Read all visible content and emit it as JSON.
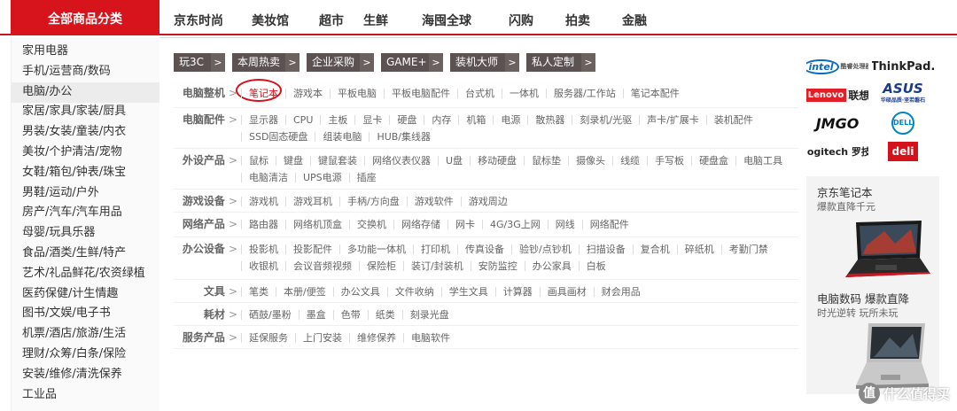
{
  "topnav": {
    "category_head": "全部商品分类",
    "links": [
      "京东时尚",
      "美妆馆",
      "超市",
      "生鲜",
      "海囤全球",
      "闪购",
      "拍卖",
      "金融"
    ]
  },
  "categories": [
    "家用电器",
    "手机/运营商/数码",
    "电脑/办公",
    "家居/家具/家装/厨具",
    "男装/女装/童装/内衣",
    "美妆/个护清洁/宠物",
    "女鞋/箱包/钟表/珠宝",
    "男鞋/运动/户外",
    "房产/汽车/汽车用品",
    "母婴/玩具乐器",
    "食品/酒类/生鲜/特产",
    "艺术/礼品鲜花/农资绿植",
    "医药保健/计生情趣",
    "图书/文娱/电子书",
    "机票/酒店/旅游/生活",
    "理财/众筹/白条/保险",
    "安装/维修/清洗保养",
    "工业品"
  ],
  "active_category_index": 2,
  "channels": [
    "玩3C",
    "本周热卖",
    "企业采购",
    "GAME+",
    "装机大师",
    "私人定制"
  ],
  "rows": [
    {
      "title": "电脑整机",
      "items": [
        "笔记本",
        "游戏本",
        "平板电脑",
        "平板电脑配件",
        "台式机",
        "一体机",
        "服务器/工作站",
        "笔记本配件"
      ]
    },
    {
      "title": "电脑配件",
      "items": [
        "显示器",
        "CPU",
        "主板",
        "显卡",
        "硬盘",
        "内存",
        "机箱",
        "电源",
        "散热器",
        "刻录机/光驱",
        "声卡/扩展卡",
        "装机配件",
        "SSD固态硬盘",
        "组装电脑",
        "HUB/集线器"
      ]
    },
    {
      "title": "外设产品",
      "items": [
        "鼠标",
        "键盘",
        "键鼠套装",
        "网络仪表仪器",
        "U盘",
        "移动硬盘",
        "鼠标垫",
        "摄像头",
        "线缆",
        "手写板",
        "硬盘盒",
        "电脑工具",
        "电脑清洁",
        "UPS电源",
        "插座"
      ]
    },
    {
      "title": "游戏设备",
      "items": [
        "游戏机",
        "游戏耳机",
        "手柄/方向盘",
        "游戏软件",
        "游戏周边"
      ]
    },
    {
      "title": "网络产品",
      "items": [
        "路由器",
        "网络机顶盒",
        "交换机",
        "网络存储",
        "网卡",
        "4G/3G上网",
        "网线",
        "网络配件"
      ]
    },
    {
      "title": "办公设备",
      "items": [
        "投影机",
        "投影配件",
        "多功能一体机",
        "打印机",
        "传真设备",
        "验钞/点钞机",
        "扫描设备",
        "复合机",
        "碎纸机",
        "考勤门禁",
        "收银机",
        "会议音频视频",
        "保险柜",
        "装订/封装机",
        "安防监控",
        "办公家具",
        "白板"
      ]
    },
    {
      "title": "文具",
      "items": [
        "笔类",
        "本册/便签",
        "办公文具",
        "文件收纳",
        "学生文具",
        "计算器",
        "画具画材",
        "财会用品"
      ]
    },
    {
      "title": "耗材",
      "items": [
        "硒鼓/墨粉",
        "墨盒",
        "色带",
        "纸类",
        "刻录光盘"
      ]
    },
    {
      "title": "服务产品",
      "items": [
        "延保服务",
        "上门安装",
        "维修保养",
        "电脑软件"
      ]
    }
  ],
  "row_arrow": ">",
  "channel_arrow": ">",
  "brands": {
    "intel": "intel",
    "intel_sub": "酷睿处理器",
    "thinkpad": "ThinkPad.",
    "lenovo": "Lenovo",
    "lenovo_cn": "联想",
    "asus": "ASUS",
    "asus_sub": "华硕品质·坚若磐石",
    "jmgo": "JMGO",
    "dell": "DELL",
    "logitech": "logitech 罗技",
    "deli": "deli"
  },
  "promos": [
    {
      "title": "京东笔记本",
      "sub": "爆款直降千元"
    },
    {
      "title": "电脑数码 爆款直降",
      "sub": "时光逆转 玩所未玩"
    }
  ],
  "watermark": {
    "badge": "值",
    "text": "什么值得买"
  },
  "colors": {
    "brand_red": "#d7141c",
    "channel_bg": "#5c5251"
  }
}
